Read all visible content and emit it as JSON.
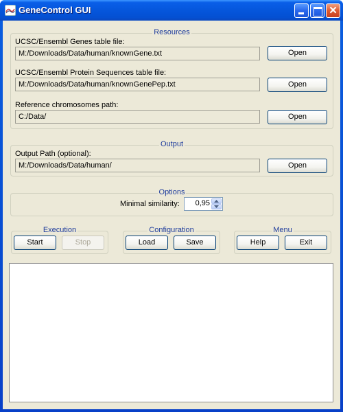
{
  "window": {
    "title": "GeneControl GUI",
    "icon": "app-logo-icon",
    "controls": {
      "minimize": "minimize-icon",
      "maximize": "maximize-icon",
      "close": "close-icon",
      "close_glyph": "✕"
    }
  },
  "resources": {
    "title": "Resources",
    "genes": {
      "label": "UCSC/Ensembl Genes table file:",
      "value": "M:/Downloads/Data/human/knownGene.txt",
      "button": "Open"
    },
    "proteins": {
      "label": "UCSC/Ensembl Protein Sequences table file:",
      "value": "M:/Downloads/Data/human/knownGenePep.txt",
      "button": "Open"
    },
    "chromosomes": {
      "label": "Reference chromosomes path:",
      "value": "C:/Data/",
      "button": "Open"
    }
  },
  "output": {
    "title": "Output",
    "label": "Output Path (optional):",
    "value": "M:/Downloads/Data/human/",
    "button": "Open"
  },
  "options": {
    "title": "Options",
    "similarity_label": "Minimal similarity:",
    "similarity_value": "0,95"
  },
  "execution": {
    "title": "Execution",
    "start": "Start",
    "stop": "Stop"
  },
  "configuration": {
    "title": "Configuration",
    "load": "Load",
    "save": "Save"
  },
  "menu": {
    "title": "Menu",
    "help": "Help",
    "exit": "Exit"
  },
  "log": {
    "text": ""
  }
}
